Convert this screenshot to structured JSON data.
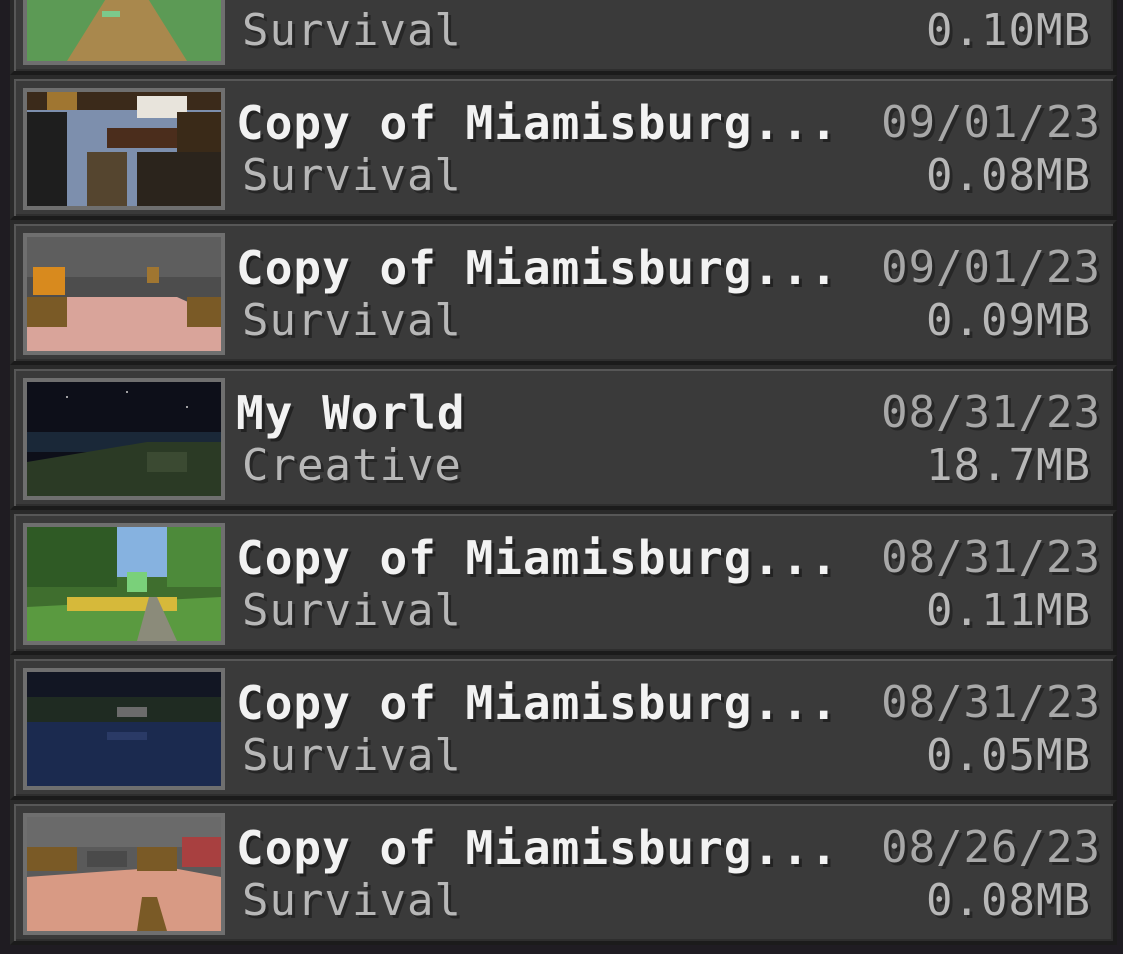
{
  "worlds": [
    {
      "name": "",
      "mode": "Survival",
      "date": "",
      "size": "0.10MB",
      "thumbnail": "grass-path-scene"
    },
    {
      "name": "Copy of Miamisburg...",
      "mode": "Survival",
      "date": "09/01/23",
      "size": "0.08MB",
      "thumbnail": "broken-house-scene"
    },
    {
      "name": "Copy of Miamisburg...",
      "mode": "Survival",
      "date": "09/01/23",
      "size": "0.09MB",
      "thumbnail": "pink-room-scene"
    },
    {
      "name": "My World",
      "mode": "Creative",
      "date": "08/31/23",
      "size": "18.7MB",
      "thumbnail": "night-landscape-scene"
    },
    {
      "name": "Copy of Miamisburg...",
      "mode": "Survival",
      "date": "08/31/23",
      "size": "0.11MB",
      "thumbnail": "tree-railway-scene"
    },
    {
      "name": "Copy of Miamisburg...",
      "mode": "Survival",
      "date": "08/31/23",
      "size": "0.05MB",
      "thumbnail": "night-water-scene"
    },
    {
      "name": "Copy of Miamisburg...",
      "mode": "Survival",
      "date": "08/26/23",
      "size": "0.08MB",
      "thumbnail": "pink-room-scene-2"
    }
  ],
  "colors": {
    "row_background": "#3a3a3a",
    "name_text": "#f2f2f2",
    "secondary_text": "#b7b7b7",
    "thumbnail_border": "#6f6f6f"
  }
}
